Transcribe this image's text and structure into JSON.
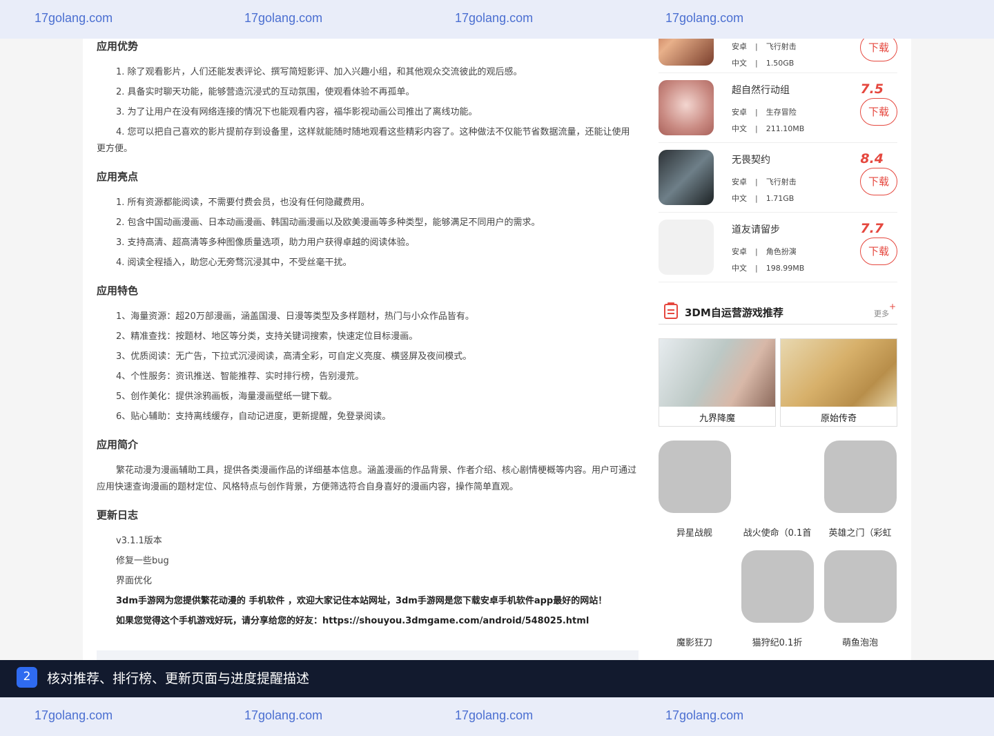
{
  "watermark": {
    "text": "17golang.com"
  },
  "sections": {
    "advantages": {
      "title": "应用优势",
      "items": [
        "1. 除了观看影片，人们还能发表评论、撰写简短影评、加入兴趣小组，和其他观众交流彼此的观后感。",
        "2. 具备实时聊天功能，能够营造沉浸式的互动氛围，使观看体验不再孤单。",
        "3. 为了让用户在没有网络连接的情况下也能观看内容，福华影视动画公司推出了离线功能。",
        "4. 您可以把自己喜欢的影片提前存到设备里，这样就能随时随地观看这些精彩内容了。这种做法不仅能节省数据流量，还能让使用更方便。"
      ]
    },
    "highlights": {
      "title": "应用亮点",
      "items": [
        "1. 所有资源都能阅读，不需要付费会员，也没有任何隐藏费用。",
        "2. 包含中国动画漫画、日本动画漫画、韩国动画漫画以及欧美漫画等多种类型，能够满足不同用户的需求。",
        "3. 支持高清、超高清等多种图像质量选项，助力用户获得卓越的阅读体验。",
        "4. 阅读全程插入，助您心无旁骛沉浸其中，不受丝毫干扰。"
      ]
    },
    "features": {
      "title": "应用特色",
      "items": [
        "1、海量资源：超20万部漫画，涵盖国漫、日漫等类型及多样题材，热门与小众作品皆有。",
        "2、精准查找：按题材、地区等分类，支持关键词搜索，快速定位目标漫画。",
        "3、优质阅读：无广告，下拉式沉浸阅读，高清全彩，可自定义亮度、横竖屏及夜间模式。",
        "4、个性服务：资讯推送、智能推荐、实时排行榜，告别漫荒。",
        "5、创作美化：提供涂鸦画板，海量漫画壁纸一键下载。",
        "6、贴心辅助：支持离线缓存，自动记进度，更新提醒，免登录阅读。"
      ]
    },
    "intro": {
      "title": "应用简介",
      "text": "繁花动漫为漫画辅助工具，提供各类漫画作品的详细基本信息。涵盖漫画的作品背景、作者介绍、核心剧情梗概等内容。用户可通过应用快速查询漫画的题材定位、风格特点与创作背景，方便筛选符合自身喜好的漫画内容，操作简单直观。"
    },
    "changelog": {
      "title": "更新日志",
      "items": [
        "v3.1.1版本",
        "修复一些bug",
        "界面优化"
      ],
      "footer1": "3dm手游网为您提供繁花动漫的 手机软件 ，欢迎大家记住本站网址，3dm手游网是您下载安卓手机软件app最好的网站！",
      "footer2": "如果您觉得这个手机游戏好玩，请分享给您的好友：https://shouyou.3dmgame.com/android/548025.html"
    }
  },
  "game_list": [
    {
      "name": "",
      "score": "",
      "platform": "安卓",
      "genre": "飞行射击",
      "lang": "中文",
      "size": "1.50GB",
      "download": "下载"
    },
    {
      "name": "超自然行动组",
      "score": "7.5",
      "platform": "安卓",
      "genre": "生存冒险",
      "lang": "中文",
      "size": "211.10MB",
      "download": "下载"
    },
    {
      "name": "无畏契约",
      "score": "8.4",
      "platform": "安卓",
      "genre": "飞行射击",
      "lang": "中文",
      "size": "1.71GB",
      "download": "下载"
    },
    {
      "name": "道友请留步",
      "score": "7.7",
      "platform": "安卓",
      "genre": "角色扮演",
      "lang": "中文",
      "size": "198.99MB",
      "download": "下载"
    }
  ],
  "recommend": {
    "title": "3DM自运营游戏推荐",
    "more": "更多",
    "plus": "+",
    "cards": [
      {
        "name": "九界降魔"
      },
      {
        "name": "原始传奇"
      }
    ],
    "tiles": [
      {
        "name": "异星战舰"
      },
      {
        "name": "战火使命（0.1首"
      },
      {
        "name": "英雄之门（彩虹"
      },
      {
        "name": "魔影狂刀"
      },
      {
        "name": "猫狩纪0.1折"
      },
      {
        "name": "萌鱼泡泡"
      }
    ]
  },
  "task": {
    "number": "2",
    "text": "核对推荐、排行榜、更新页面与进度提醒描述"
  },
  "colors": {
    "accent_red": "#e5473e",
    "task_bg": "#121a2e",
    "task_badge": "#2f6bf0",
    "watermark": "#4b6fd1"
  }
}
